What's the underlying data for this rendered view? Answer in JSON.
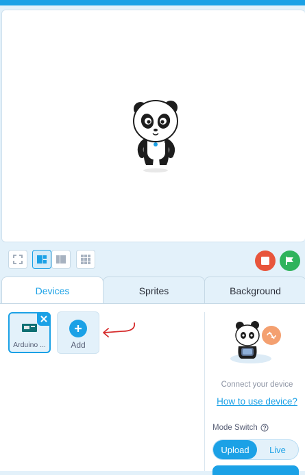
{
  "tabs": [
    {
      "label": "Devices"
    },
    {
      "label": "Sprites"
    },
    {
      "label": "Background"
    }
  ],
  "devices": {
    "items": [
      {
        "label": "Arduino ..."
      }
    ],
    "add_label": "Add"
  },
  "connect": {
    "message": "Connect your device",
    "link": "How to use device?",
    "mode_label": "Mode Switch",
    "mode_options": [
      "Upload",
      "Live"
    ],
    "selected_mode": "Upload"
  },
  "colors": {
    "accent": "#1ba1e6",
    "stop": "#e8553c",
    "go": "#2fb35c"
  }
}
